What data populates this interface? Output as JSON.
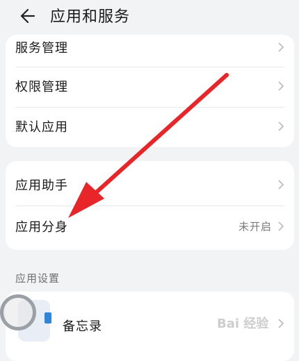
{
  "header": {
    "title": "应用和服务"
  },
  "group1": {
    "items": [
      {
        "label": "服务管理"
      },
      {
        "label": "权限管理"
      },
      {
        "label": "默认应用"
      }
    ]
  },
  "group2": {
    "items": [
      {
        "label": "应用助手",
        "value": ""
      },
      {
        "label": "应用分身",
        "value": "未开启"
      }
    ]
  },
  "settings": {
    "section_label": "应用设置",
    "apps": [
      {
        "name": "备忘录"
      }
    ]
  },
  "watermark": {
    "text": "Bai 经验"
  },
  "colors": {
    "arrow": "#e8262a",
    "background": "#f1f3f5",
    "card": "#ffffff"
  },
  "icons": [
    "back-arrow-icon",
    "chevron-right-icon",
    "notepad-icon"
  ]
}
